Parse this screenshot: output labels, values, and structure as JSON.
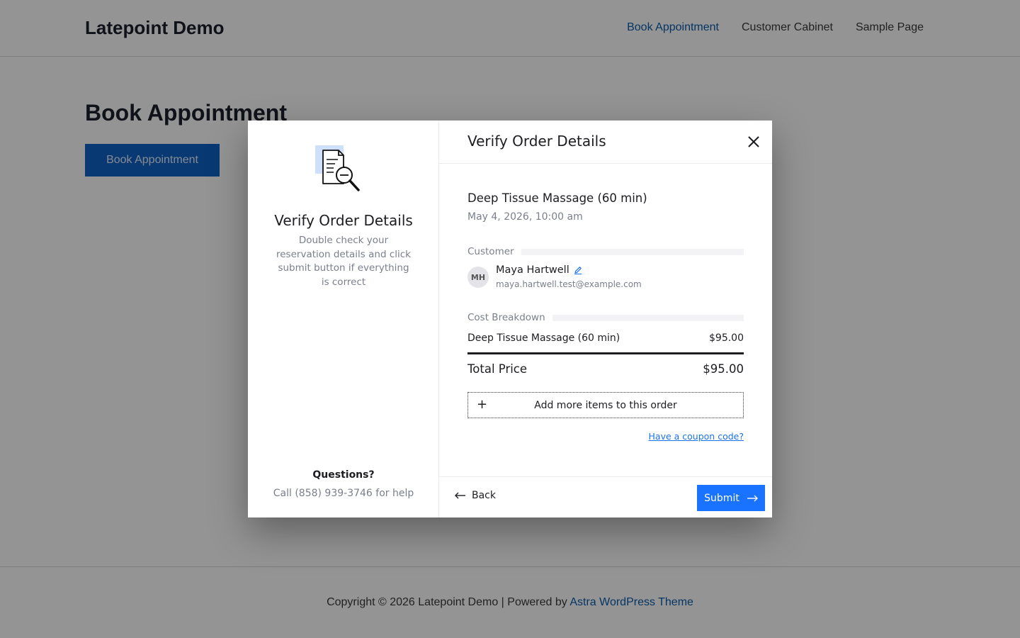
{
  "site": {
    "title": "Latepoint Demo",
    "nav": [
      "Book Appointment",
      "Customer Cabinet",
      "Sample Page"
    ],
    "page_heading": "Book Appointment",
    "page_button": "Book Appointment",
    "footer_prefix": "Copyright © 2026 Latepoint Demo | Powered by ",
    "footer_link": "Astra WordPress Theme"
  },
  "modal": {
    "side": {
      "title": "Verify Order Details",
      "description": "Double check your reservation details and click submit button if everything is correct",
      "questions": "Questions?",
      "call": "Call (858) 939-3746 for help"
    },
    "header_title": "Verify Order Details",
    "service": {
      "name": "Deep Tissue Massage (60 min)",
      "datetime": "May 4, 2026, 10:00 am"
    },
    "customer": {
      "label": "Customer",
      "initials": "MH",
      "name": "Maya Hartwell",
      "email": "maya.hartwell.test@example.com"
    },
    "cost": {
      "label": "Cost Breakdown",
      "item_name": "Deep Tissue Massage (60 min)",
      "item_price": "$95.00",
      "total_label": "Total Price",
      "total_value": "$95.00"
    },
    "add_items": "Add more items to this order",
    "coupon": "Have a coupon code?",
    "back": "Back",
    "submit": "Submit"
  },
  "colors": {
    "accent": "#1a73ff",
    "link": "#0b5cad",
    "overlay": "rgba(0,0,0,0.42)"
  }
}
